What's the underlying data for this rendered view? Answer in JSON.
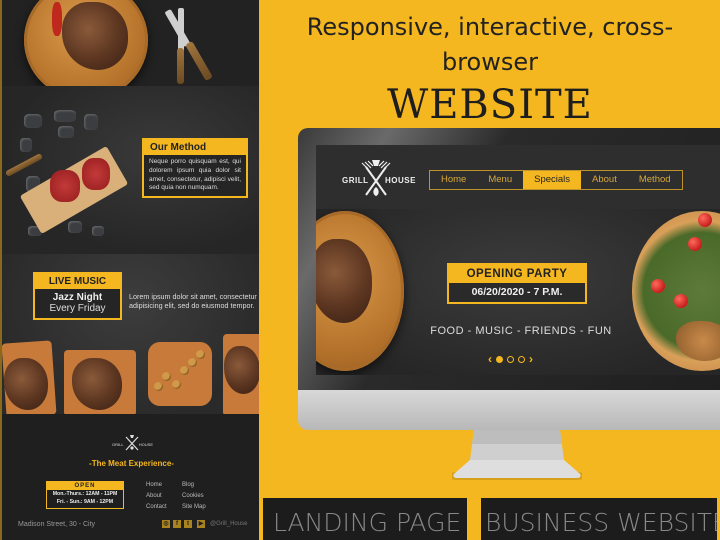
{
  "headline": {
    "line1": "Responsive, interactive, cross-",
    "line2": "browser",
    "main": "WEBSITE"
  },
  "left_panel": {
    "method": {
      "title": "Our Method",
      "text": "Neque porro quisquam est, qui dolorem ipsum quia dolor sit amet, consectetur, adipisci velit, sed quia non numquam."
    },
    "live_music": {
      "title": "LIVE MUSIC",
      "line1": "Jazz Night",
      "line2": "Every Friday",
      "description": "Lorem ipsum dolor sit amet, consectetur adipisicing elit, sed do eiusmod tempor."
    },
    "footer": {
      "logo_left": "GRILL",
      "logo_right": "HOUSE",
      "tagline": "-The Meat Experience-",
      "open_title": "OPEN",
      "hours": [
        "Mon.-Thurs.: 12AM - 11PM",
        "Fri. - Sun.: 9AM - 12PM"
      ],
      "links_col1": [
        "Home",
        "About",
        "Contact"
      ],
      "links_col2": [
        "Blog",
        "Cookies",
        "Site Map"
      ],
      "address": "Madison Street, 30 - City",
      "social_icons": [
        "instagram-icon",
        "facebook-icon",
        "twitter-icon",
        "youtube-icon"
      ],
      "social_glyphs": [
        "◎",
        "f",
        "t",
        "▶"
      ],
      "handle": "@Grill_House"
    }
  },
  "site_preview": {
    "logo_left": "GRILL",
    "logo_right": "HOUSE",
    "menu": [
      {
        "label": "Home",
        "active": false
      },
      {
        "label": "Menu",
        "active": false
      },
      {
        "label": "Specials",
        "active": true
      },
      {
        "label": "About",
        "active": false
      },
      {
        "label": "Method",
        "active": false
      }
    ],
    "hero": {
      "title": "OPENING PARTY",
      "date": "06/20/2020 - 7 P.M.",
      "tagline": "FOOD - MUSIC - FRIENDS - FUN",
      "carousel_prev": "‹",
      "carousel_next": "›",
      "slide_count": 3,
      "active_slide": 1
    }
  },
  "labels": {
    "landing": "LANDING PAGE",
    "business": "BUSINESS WEBSITE"
  },
  "colors": {
    "accent": "#f5b71f",
    "dark": "#1c1c1c"
  }
}
